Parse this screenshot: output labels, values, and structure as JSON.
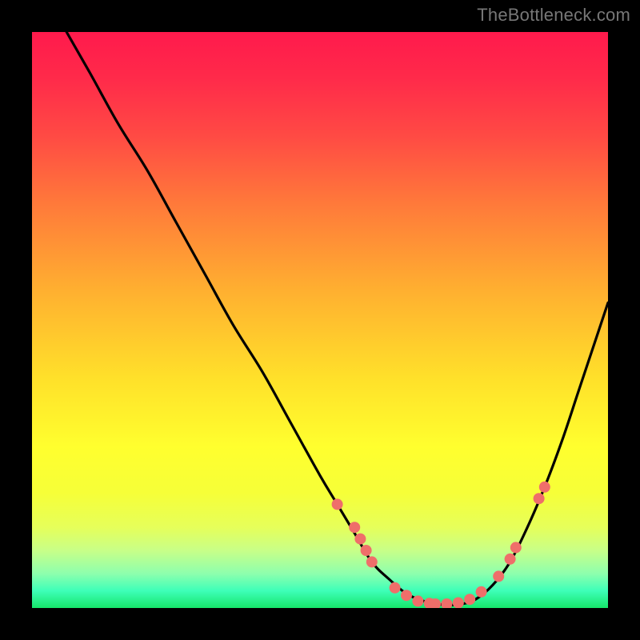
{
  "watermark": "TheBottleneck.com",
  "colors": {
    "background": "#000000",
    "curve": "#000000",
    "dot": "#ef6e6a",
    "gradient_top": "#ff1a4c",
    "gradient_bottom": "#16e66a"
  },
  "chart_data": {
    "type": "line",
    "title": "",
    "xlabel": "",
    "ylabel": "",
    "xlim": [
      0,
      100
    ],
    "ylim": [
      0,
      100
    ],
    "grid": false,
    "legend": false,
    "series": [
      {
        "name": "bottleneck-curve",
        "x": [
          6,
          10,
          15,
          20,
          25,
          30,
          35,
          40,
          45,
          50,
          53,
          56,
          59,
          62,
          65,
          68,
          71,
          74,
          77,
          80,
          83,
          86,
          89,
          92,
          95,
          98,
          100
        ],
        "y": [
          100,
          93,
          84,
          76,
          67,
          58,
          49,
          41,
          32,
          23,
          18,
          13,
          8,
          5,
          2.5,
          1.2,
          0.6,
          0.6,
          1.5,
          4,
          8,
          14,
          21,
          29,
          38,
          47,
          53
        ]
      }
    ],
    "highlight_dots": {
      "name": "sampled-points",
      "points": [
        {
          "x": 53,
          "y": 18
        },
        {
          "x": 56,
          "y": 14
        },
        {
          "x": 57,
          "y": 12
        },
        {
          "x": 58,
          "y": 10
        },
        {
          "x": 59,
          "y": 8
        },
        {
          "x": 63,
          "y": 3.5
        },
        {
          "x": 65,
          "y": 2.2
        },
        {
          "x": 67,
          "y": 1.2
        },
        {
          "x": 69,
          "y": 0.8
        },
        {
          "x": 70,
          "y": 0.7
        },
        {
          "x": 72,
          "y": 0.7
        },
        {
          "x": 74,
          "y": 0.9
        },
        {
          "x": 76,
          "y": 1.5
        },
        {
          "x": 78,
          "y": 2.8
        },
        {
          "x": 81,
          "y": 5.5
        },
        {
          "x": 83,
          "y": 8.5
        },
        {
          "x": 84,
          "y": 10.5
        },
        {
          "x": 88,
          "y": 19
        },
        {
          "x": 89,
          "y": 21
        }
      ]
    }
  }
}
